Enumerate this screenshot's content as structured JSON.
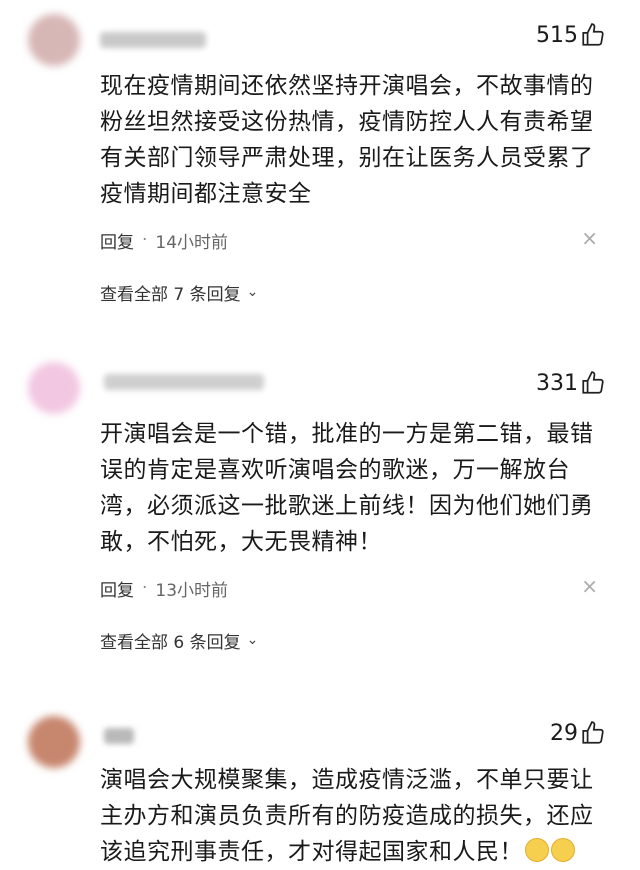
{
  "comments": [
    {
      "likes": "515",
      "text_lines": [
        "现在疫情期间还依然坚持开演唱会，不故事情的",
        "粉丝坦然接受这份热情，疫情防控人人有责希望",
        "有关部门领导严肃处理，别在让医务人员受累了",
        "疫情期间都注意安全"
      ],
      "reply_label": "回复",
      "time": "14小时前",
      "replies_label": "查看全部 7 条回复"
    },
    {
      "likes": "331",
      "text_lines": [
        "开演唱会是一个错，批准的一方是第二错，最错",
        "误的肯定是喜欢听演唱会的歌迷，万一解放台",
        "湾，必须派这一批歌迷上前线！因为他们她们勇",
        "敢，不怕死，大无畏精神！"
      ],
      "reply_label": "回复",
      "time": "13小时前",
      "replies_label": "查看全部 6 条回复"
    },
    {
      "likes": "29",
      "text_lines": [
        "演唱会大规模聚集，造成疫情泛滥，不单只要让",
        "主办方和演员负责所有的防疫造成的损失，还应",
        "该追究刑事责任，才对得起国家和人民！"
      ]
    }
  ],
  "close_glyph": "×",
  "colors": {
    "avatar1": "#d7b7b5",
    "avatar2": "#f2c7e2",
    "avatar3": "#c7866e"
  }
}
